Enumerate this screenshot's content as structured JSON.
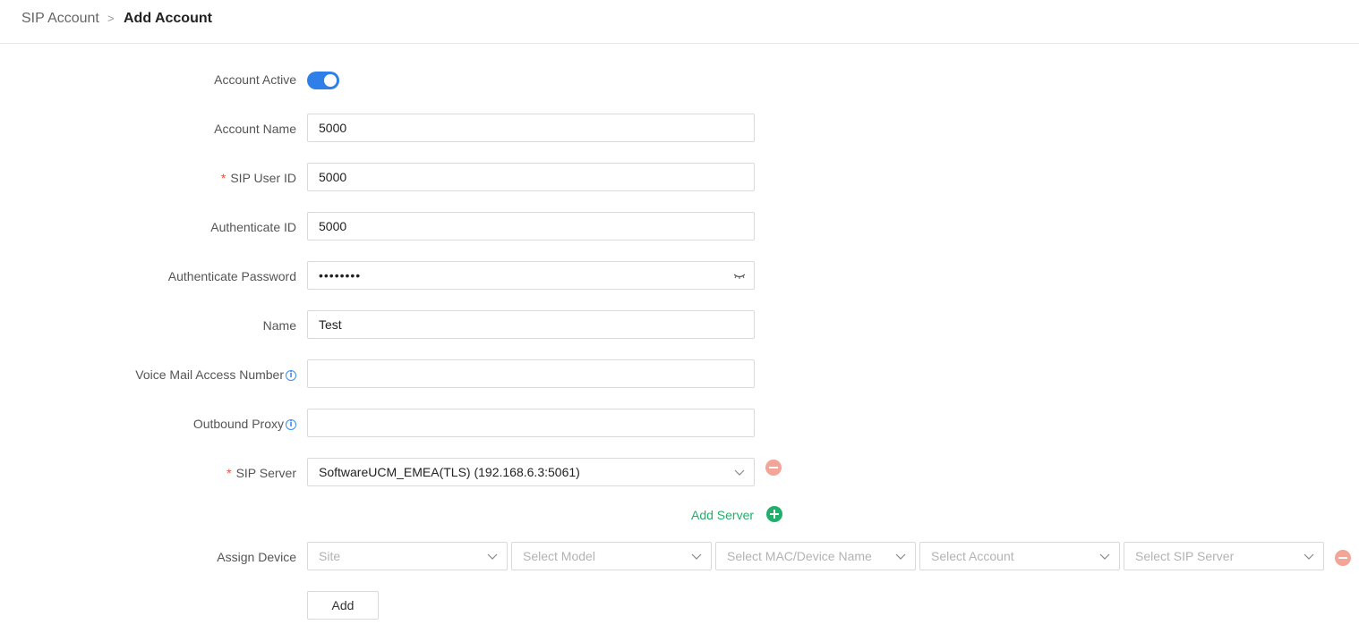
{
  "breadcrumb": {
    "parent": "SIP Account",
    "separator": ">",
    "current": "Add Account"
  },
  "colors": {
    "accent": "#2f7fe8",
    "required": "#e8533c",
    "success": "#20b06c",
    "danger_soft": "#f3a597"
  },
  "form": {
    "account_active": {
      "label": "Account Active",
      "on": true
    },
    "account_name": {
      "label": "Account Name",
      "value": "5000"
    },
    "sip_user_id": {
      "label": "SIP User ID",
      "required_mark": "*",
      "value": "5000"
    },
    "authenticate_id": {
      "label": "Authenticate ID",
      "value": "5000"
    },
    "authenticate_password": {
      "label": "Authenticate Password",
      "value": "••••••••",
      "icon": "eye-closed-icon"
    },
    "name": {
      "label": "Name",
      "value": "Test"
    },
    "voice_mail_access_number": {
      "label": "Voice Mail Access Number",
      "info": "i",
      "value": ""
    },
    "outbound_proxy": {
      "label": "Outbound Proxy",
      "info": "i",
      "value": ""
    },
    "sip_server": {
      "label": "SIP Server",
      "required_mark": "*",
      "value": "SoftwareUCM_EMEA(TLS) (192.168.6.3:5061)"
    },
    "add_server": {
      "label": "Add Server"
    },
    "assign_device": {
      "label": "Assign Device",
      "site_placeholder": "Site",
      "model_placeholder": "Select Model",
      "mac_placeholder": "Select MAC/Device Name",
      "account_placeholder": "Select Account",
      "sip_server_placeholder": "Select SIP Server"
    },
    "add_button": "Add"
  }
}
